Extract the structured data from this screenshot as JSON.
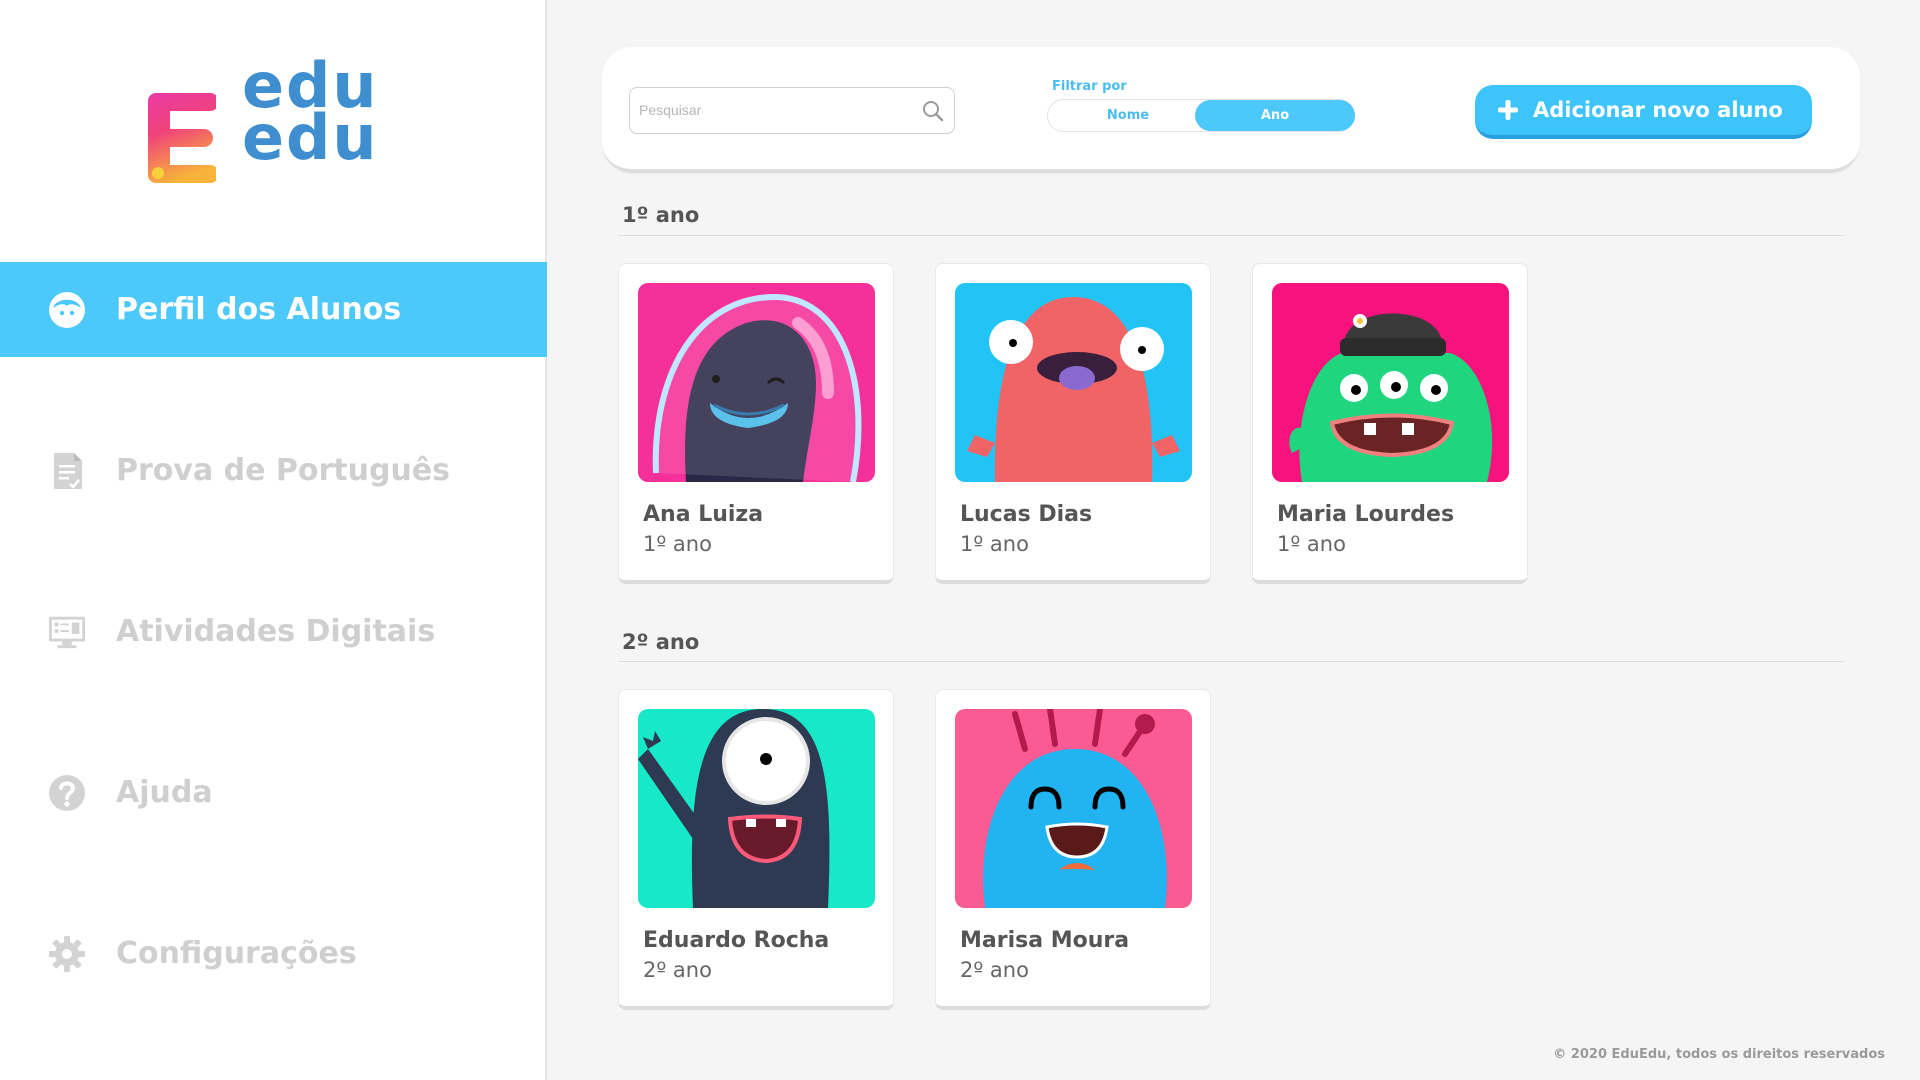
{
  "brand": {
    "line1": "edu",
    "line2": "edu"
  },
  "sidebar": {
    "items": [
      {
        "label": "Perfil dos Alunos",
        "icon": "student-face-icon",
        "active": true
      },
      {
        "label": "Prova de Português",
        "icon": "document-check-icon",
        "active": false
      },
      {
        "label": "Atividades Digitais",
        "icon": "monitor-activities-icon",
        "active": false
      },
      {
        "label": "Ajuda",
        "icon": "help-circle-icon",
        "active": false
      },
      {
        "label": "Configurações",
        "icon": "gear-icon",
        "active": false
      }
    ]
  },
  "topbar": {
    "search": {
      "placeholder": "Pesquisar",
      "value": ""
    },
    "filter": {
      "label": "Filtrar por",
      "options": [
        "Nome",
        "Ano"
      ],
      "selected": "Ano"
    },
    "add_button": "Adicionar novo aluno"
  },
  "sections": [
    {
      "title": "1º ano",
      "students": [
        {
          "name": "Ana Luiza",
          "grade": "1º ano",
          "avatar": "astronaut-monster",
          "bg": "#f5309a"
        },
        {
          "name": "Lucas Dias",
          "grade": "1º ano",
          "avatar": "red-monster",
          "bg": "#22c4f5"
        },
        {
          "name": "Maria Lourdes",
          "grade": "1º ano",
          "avatar": "green-three-eyed-monster",
          "bg": "#f7127d"
        }
      ]
    },
    {
      "title": "2º ano",
      "students": [
        {
          "name": "Eduardo Rocha",
          "grade": "2º ano",
          "avatar": "one-eyed-monster",
          "bg": "#17e8c8"
        },
        {
          "name": "Marisa Moura",
          "grade": "2º ano",
          "avatar": "blue-antenna-monster",
          "bg": "#fb5b93"
        }
      ]
    }
  ],
  "colors": {
    "accent": "#4cc8fb",
    "accent_dark": "#279fe0",
    "text": "#555555",
    "inactive": "#cfcfcf"
  },
  "footer": "© 2020 EduEdu, todos os direitos reservados"
}
